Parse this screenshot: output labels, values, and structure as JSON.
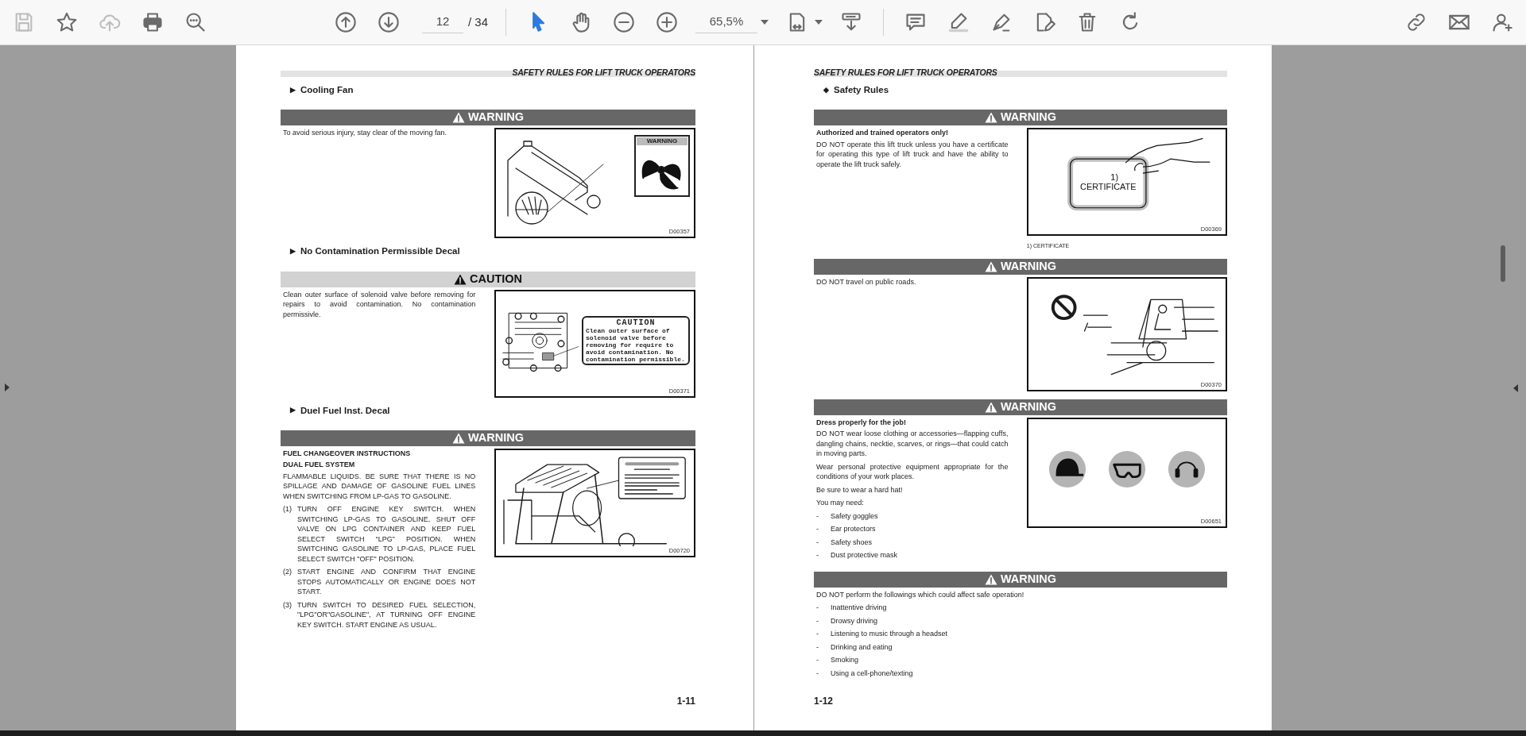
{
  "toolbar": {
    "file_tools": [
      {
        "kind": "save",
        "disabled": true,
        "selected": false
      },
      {
        "kind": "bookmark",
        "disabled": false,
        "selected": false
      },
      {
        "kind": "upload",
        "disabled": true,
        "selected": false
      },
      {
        "kind": "print",
        "disabled": false,
        "selected": false
      },
      {
        "kind": "find",
        "disabled": false,
        "selected": false
      }
    ],
    "page_nav": {
      "tools": [
        {
          "kind": "prev",
          "disabled": false,
          "selected": false
        },
        {
          "kind": "next",
          "disabled": false,
          "selected": false
        }
      ],
      "current": "12",
      "total": "/ 34"
    },
    "view_tools": [
      {
        "kind": "select",
        "disabled": false,
        "selected": true
      },
      {
        "kind": "hand",
        "disabled": false,
        "selected": false
      },
      {
        "kind": "zoom_out",
        "disabled": false,
        "selected": false
      },
      {
        "kind": "zoom_in",
        "disabled": false,
        "selected": false
      }
    ],
    "zoom": "65,5%",
    "layout_tools": [
      {
        "kind": "fit",
        "disabled": false,
        "selected": false
      },
      {
        "kind": "scroll",
        "disabled": false,
        "selected": false
      }
    ],
    "edit_tools": [
      {
        "kind": "comment",
        "disabled": false,
        "selected": false
      },
      {
        "kind": "highlight",
        "disabled": false,
        "selected": false
      },
      {
        "kind": "sign",
        "disabled": false,
        "selected": false
      },
      {
        "kind": "edit",
        "disabled": false,
        "selected": false
      },
      {
        "kind": "delete",
        "disabled": false,
        "selected": false
      },
      {
        "kind": "rotate",
        "disabled": false,
        "selected": false
      }
    ],
    "share_tools": [
      {
        "kind": "link",
        "disabled": false,
        "selected": false
      },
      {
        "kind": "mail",
        "disabled": false,
        "selected": false
      },
      {
        "kind": "adduser",
        "disabled": false,
        "selected": false
      }
    ]
  },
  "pages": [
    {
      "header": "SAFETY RULES FOR LIFT TRUCK OPERATORS",
      "page_number": "1-11",
      "blocks": [
        {
          "kind": "heading",
          "marker": "▶",
          "text": "Cooling Fan"
        },
        {
          "kind": "warning",
          "label": "WARNING",
          "body": [
            {
              "kind": "text",
              "text": "To avoid serious injury, stay clear of the moving fan."
            }
          ],
          "figure": {
            "kind": "fan",
            "decal_title": "WARNING",
            "code": "D00357"
          }
        },
        {
          "kind": "heading",
          "marker": "▶",
          "text": "No Contamination Permissible Decal"
        },
        {
          "kind": "caution",
          "label": "CAUTION",
          "body": [
            {
              "kind": "text",
              "text": "Clean outer surface of solenoid valve before removing for repairs to avoid contamination. No contamination permissivle."
            }
          ],
          "figure": {
            "kind": "valve",
            "decal_title": "CAUTION",
            "decal_text": "Clean outer surface of solenoid valve before removing for require to avoid contamination. No contamination permissible.",
            "code": "D00371"
          }
        },
        {
          "kind": "heading",
          "marker": "▶",
          "text": "Duel Fuel Inst. Decal"
        },
        {
          "kind": "warning",
          "label": "WARNING",
          "body": [
            {
              "kind": "lead",
              "text": "FUEL CHANGEOVER INSTRUCTIONS"
            },
            {
              "kind": "lead",
              "text": "DUAL FUEL SYSTEM"
            },
            {
              "kind": "text",
              "text": "FLAMMABLE LIQUIDS. BE SURE THAT THERE IS NO SPILLAGE AND DAMAGE OF GASOLINE FUEL LINES WHEN SWITCHING FROM LP-GAS TO GASOLINE."
            },
            {
              "kind": "numbered",
              "mark": "(1)",
              "text": "TURN OFF ENGINE KEY SWITCH. WHEN SWITCHING LP-GAS TO GASOLINE, SHUT OFF VALVE ON LPG CONTAINER AND KEEP FUEL SELECT SWITCH “LPG” POSITION. WHEN SWITCHING GASOLINE TO LP-GAS, PLACE FUEL SELECT SWITCH \"OFF\" POSITION."
            },
            {
              "kind": "numbered",
              "mark": "(2)",
              "text": "START ENGINE AND CONFIRM THAT ENGINE STOPS AUTOMATICALLY OR ENGINE DOES NOT START."
            },
            {
              "kind": "numbered",
              "mark": "(3)",
              "text": "TURN SWITCH TO DESIRED FUEL SELECTION, \"LPG\"OR\"GASOLINE\", AT TURNING OFF ENGINE KEY SWITCH. START ENGINE AS USUAL."
            }
          ],
          "figure": {
            "kind": "cab",
            "code": "D00720"
          }
        }
      ]
    },
    {
      "header": "SAFETY RULES FOR LIFT TRUCK OPERATORS",
      "page_number": "1-12",
      "blocks": [
        {
          "kind": "heading",
          "marker": "◆",
          "text": "Safety Rules"
        },
        {
          "kind": "warning",
          "label": "WARNING",
          "body": [
            {
              "kind": "lead",
              "text": "Authorized and trained operators only!"
            },
            {
              "kind": "text",
              "text": "DO NOT operate this lift truck unless you have a certificate for operating this type of lift truck and have the ability to operate the lift truck safely."
            }
          ],
          "figure": {
            "kind": "certificate",
            "card_number": "1)",
            "card_text": "CERTIFICATE",
            "code": "D00369",
            "caption": "1) CERTIFICATE"
          }
        },
        {
          "kind": "warning",
          "label": "WARNING",
          "body": [
            {
              "kind": "text",
              "text": "DO NOT travel on public roads."
            }
          ],
          "figure": {
            "kind": "road",
            "code": "D00370"
          }
        },
        {
          "kind": "warning",
          "label": "WARNING",
          "body": [
            {
              "kind": "lead",
              "text": "Dress properly for the job!"
            },
            {
              "kind": "text",
              "text": "DO NOT wear loose clothing or accessories—flapping cuffs, dangling chains, necktie, scarves, or rings—that could catch in moving parts."
            },
            {
              "kind": "text",
              "text": "Wear personal protective equipment appropriate for the conditions of your work places."
            },
            {
              "kind": "text",
              "text": "Be sure to wear a hard hat!"
            },
            {
              "kind": "text",
              "text": "You may need:"
            },
            {
              "kind": "bullet",
              "mark": "-",
              "text": "Safety goggles"
            },
            {
              "kind": "bullet",
              "mark": "-",
              "text": "Ear protectors"
            },
            {
              "kind": "bullet",
              "mark": "-",
              "text": "Safety shoes"
            },
            {
              "kind": "bullet",
              "mark": "-",
              "text": "Dust protective mask"
            }
          ],
          "figure": {
            "kind": "ppe",
            "code": "D00651"
          }
        },
        {
          "kind": "warning",
          "label": "WARNING",
          "body": [
            {
              "kind": "text",
              "text": "DO NOT perform the followings which could affect safe operation!"
            },
            {
              "kind": "bullet",
              "mark": "-",
              "text": "Inattentive driving"
            },
            {
              "kind": "bullet",
              "mark": "-",
              "text": "Drowsy driving"
            },
            {
              "kind": "bullet",
              "mark": "-",
              "text": "Listening to music through a headset"
            },
            {
              "kind": "bullet",
              "mark": "-",
              "text": "Drinking and eating"
            },
            {
              "kind": "bullet",
              "mark": "-",
              "text": "Smoking"
            },
            {
              "kind": "bullet",
              "mark": "-",
              "text": "Using a cell-phone/texting"
            }
          ]
        }
      ]
    }
  ]
}
